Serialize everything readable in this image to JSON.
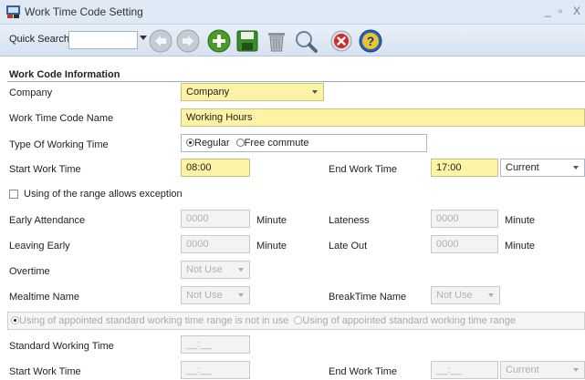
{
  "window": {
    "title": "Work Time Code Setting",
    "minimize": "_",
    "restore": "▫",
    "close": "X"
  },
  "toolbar": {
    "quick_search_label": "Quick Search",
    "quick_search_value": ""
  },
  "section": {
    "title": "Work Code Information"
  },
  "form": {
    "company_label": "Company",
    "company_value": "Company",
    "work_time_code_name_label": "Work Time Code Name",
    "work_time_code_name_value": "Working Hours",
    "type_label": "Type Of Working Time",
    "type_regular": "Regular",
    "type_free": "Free commute",
    "start_work_time_label": "Start Work Time",
    "start_work_time_value": "08:00",
    "end_work_time_label": "End Work Time",
    "end_work_time_value": "17:00",
    "end_day_value": "Current",
    "range_exception_label": "Using of the range allows exception",
    "early_attendance_label": "Early Attendance",
    "early_attendance_value": "0000",
    "lateness_label": "Lateness",
    "lateness_value": "0000",
    "leaving_early_label": "Leaving Early",
    "leaving_early_value": "0000",
    "late_out_label": "Late Out",
    "late_out_value": "0000",
    "minute_unit": "Minute",
    "overtime_label": "Overtime",
    "overtime_value": "Not Use",
    "mealtime_label": "Mealtime Name",
    "mealtime_value": "Not Use",
    "breaktime_label": "BreakTime Name",
    "breaktime_value": "Not Use",
    "range_not_in_use": "Using of appointed standard working time range is not in use",
    "range_in_use": "Using of appointed standard working time range",
    "standard_working_time_label": "Standard Working Time",
    "time_placeholder": "__:__",
    "start_work_time2_label": "Start Work Time",
    "end_work_time2_label": "End Work Time",
    "end_day2_value": "Current"
  },
  "colors": {
    "required": "#fdf3a5",
    "disabled": "#f3f3f3",
    "titlebar": "#dfe9f5"
  }
}
